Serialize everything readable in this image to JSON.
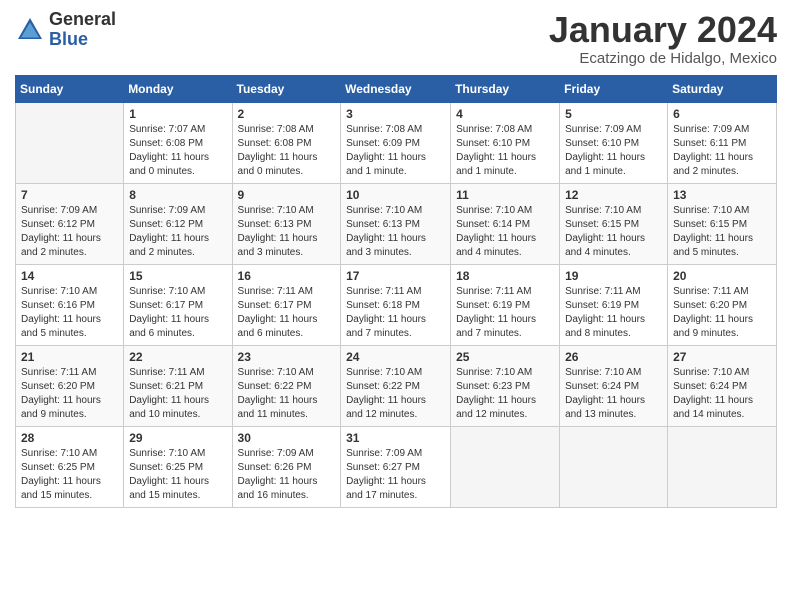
{
  "logo": {
    "general": "General",
    "blue": "Blue"
  },
  "title": "January 2024",
  "location": "Ecatzingo de Hidalgo, Mexico",
  "weekdays": [
    "Sunday",
    "Monday",
    "Tuesday",
    "Wednesday",
    "Thursday",
    "Friday",
    "Saturday"
  ],
  "weeks": [
    [
      {
        "day": "",
        "sunrise": "",
        "sunset": "",
        "daylight": ""
      },
      {
        "day": "1",
        "sunrise": "Sunrise: 7:07 AM",
        "sunset": "Sunset: 6:08 PM",
        "daylight": "Daylight: 11 hours and 0 minutes."
      },
      {
        "day": "2",
        "sunrise": "Sunrise: 7:08 AM",
        "sunset": "Sunset: 6:08 PM",
        "daylight": "Daylight: 11 hours and 0 minutes."
      },
      {
        "day": "3",
        "sunrise": "Sunrise: 7:08 AM",
        "sunset": "Sunset: 6:09 PM",
        "daylight": "Daylight: 11 hours and 1 minute."
      },
      {
        "day": "4",
        "sunrise": "Sunrise: 7:08 AM",
        "sunset": "Sunset: 6:10 PM",
        "daylight": "Daylight: 11 hours and 1 minute."
      },
      {
        "day": "5",
        "sunrise": "Sunrise: 7:09 AM",
        "sunset": "Sunset: 6:10 PM",
        "daylight": "Daylight: 11 hours and 1 minute."
      },
      {
        "day": "6",
        "sunrise": "Sunrise: 7:09 AM",
        "sunset": "Sunset: 6:11 PM",
        "daylight": "Daylight: 11 hours and 2 minutes."
      }
    ],
    [
      {
        "day": "7",
        "sunrise": "Sunrise: 7:09 AM",
        "sunset": "Sunset: 6:12 PM",
        "daylight": "Daylight: 11 hours and 2 minutes."
      },
      {
        "day": "8",
        "sunrise": "Sunrise: 7:09 AM",
        "sunset": "Sunset: 6:12 PM",
        "daylight": "Daylight: 11 hours and 2 minutes."
      },
      {
        "day": "9",
        "sunrise": "Sunrise: 7:10 AM",
        "sunset": "Sunset: 6:13 PM",
        "daylight": "Daylight: 11 hours and 3 minutes."
      },
      {
        "day": "10",
        "sunrise": "Sunrise: 7:10 AM",
        "sunset": "Sunset: 6:13 PM",
        "daylight": "Daylight: 11 hours and 3 minutes."
      },
      {
        "day": "11",
        "sunrise": "Sunrise: 7:10 AM",
        "sunset": "Sunset: 6:14 PM",
        "daylight": "Daylight: 11 hours and 4 minutes."
      },
      {
        "day": "12",
        "sunrise": "Sunrise: 7:10 AM",
        "sunset": "Sunset: 6:15 PM",
        "daylight": "Daylight: 11 hours and 4 minutes."
      },
      {
        "day": "13",
        "sunrise": "Sunrise: 7:10 AM",
        "sunset": "Sunset: 6:15 PM",
        "daylight": "Daylight: 11 hours and 5 minutes."
      }
    ],
    [
      {
        "day": "14",
        "sunrise": "Sunrise: 7:10 AM",
        "sunset": "Sunset: 6:16 PM",
        "daylight": "Daylight: 11 hours and 5 minutes."
      },
      {
        "day": "15",
        "sunrise": "Sunrise: 7:10 AM",
        "sunset": "Sunset: 6:17 PM",
        "daylight": "Daylight: 11 hours and 6 minutes."
      },
      {
        "day": "16",
        "sunrise": "Sunrise: 7:11 AM",
        "sunset": "Sunset: 6:17 PM",
        "daylight": "Daylight: 11 hours and 6 minutes."
      },
      {
        "day": "17",
        "sunrise": "Sunrise: 7:11 AM",
        "sunset": "Sunset: 6:18 PM",
        "daylight": "Daylight: 11 hours and 7 minutes."
      },
      {
        "day": "18",
        "sunrise": "Sunrise: 7:11 AM",
        "sunset": "Sunset: 6:19 PM",
        "daylight": "Daylight: 11 hours and 7 minutes."
      },
      {
        "day": "19",
        "sunrise": "Sunrise: 7:11 AM",
        "sunset": "Sunset: 6:19 PM",
        "daylight": "Daylight: 11 hours and 8 minutes."
      },
      {
        "day": "20",
        "sunrise": "Sunrise: 7:11 AM",
        "sunset": "Sunset: 6:20 PM",
        "daylight": "Daylight: 11 hours and 9 minutes."
      }
    ],
    [
      {
        "day": "21",
        "sunrise": "Sunrise: 7:11 AM",
        "sunset": "Sunset: 6:20 PM",
        "daylight": "Daylight: 11 hours and 9 minutes."
      },
      {
        "day": "22",
        "sunrise": "Sunrise: 7:11 AM",
        "sunset": "Sunset: 6:21 PM",
        "daylight": "Daylight: 11 hours and 10 minutes."
      },
      {
        "day": "23",
        "sunrise": "Sunrise: 7:10 AM",
        "sunset": "Sunset: 6:22 PM",
        "daylight": "Daylight: 11 hours and 11 minutes."
      },
      {
        "day": "24",
        "sunrise": "Sunrise: 7:10 AM",
        "sunset": "Sunset: 6:22 PM",
        "daylight": "Daylight: 11 hours and 12 minutes."
      },
      {
        "day": "25",
        "sunrise": "Sunrise: 7:10 AM",
        "sunset": "Sunset: 6:23 PM",
        "daylight": "Daylight: 11 hours and 12 minutes."
      },
      {
        "day": "26",
        "sunrise": "Sunrise: 7:10 AM",
        "sunset": "Sunset: 6:24 PM",
        "daylight": "Daylight: 11 hours and 13 minutes."
      },
      {
        "day": "27",
        "sunrise": "Sunrise: 7:10 AM",
        "sunset": "Sunset: 6:24 PM",
        "daylight": "Daylight: 11 hours and 14 minutes."
      }
    ],
    [
      {
        "day": "28",
        "sunrise": "Sunrise: 7:10 AM",
        "sunset": "Sunset: 6:25 PM",
        "daylight": "Daylight: 11 hours and 15 minutes."
      },
      {
        "day": "29",
        "sunrise": "Sunrise: 7:10 AM",
        "sunset": "Sunset: 6:25 PM",
        "daylight": "Daylight: 11 hours and 15 minutes."
      },
      {
        "day": "30",
        "sunrise": "Sunrise: 7:09 AM",
        "sunset": "Sunset: 6:26 PM",
        "daylight": "Daylight: 11 hours and 16 minutes."
      },
      {
        "day": "31",
        "sunrise": "Sunrise: 7:09 AM",
        "sunset": "Sunset: 6:27 PM",
        "daylight": "Daylight: 11 hours and 17 minutes."
      },
      {
        "day": "",
        "sunrise": "",
        "sunset": "",
        "daylight": ""
      },
      {
        "day": "",
        "sunrise": "",
        "sunset": "",
        "daylight": ""
      },
      {
        "day": "",
        "sunrise": "",
        "sunset": "",
        "daylight": ""
      }
    ]
  ]
}
